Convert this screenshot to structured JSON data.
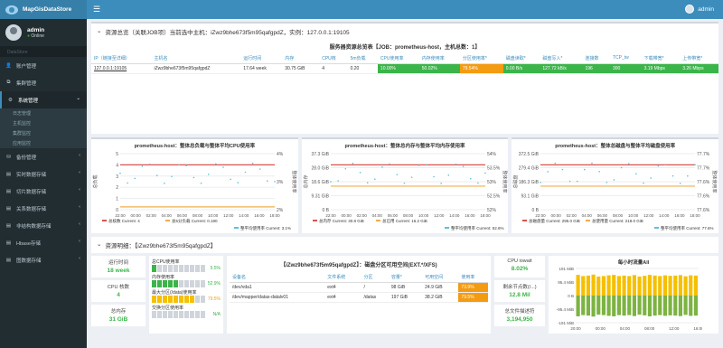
{
  "app": {
    "name": "MapGisDataStore",
    "user": "admin",
    "status": "Online"
  },
  "sidebar": {
    "head": "DataStore",
    "items": [
      {
        "label": "账户管理",
        "icon": "user-icon"
      },
      {
        "label": "集群管理",
        "icon": "cluster-icon"
      },
      {
        "label": "系统管理",
        "icon": "gear-icon",
        "sub": [
          "日志管理",
          "主机监控",
          "集群监控",
          "应用监控"
        ]
      },
      {
        "label": "备份管理",
        "icon": "backup-icon"
      },
      {
        "label": "实时数据存储",
        "icon": "database-icon"
      },
      {
        "label": "切片数据存储",
        "icon": "database-icon"
      },
      {
        "label": "关系数据存储",
        "icon": "database-icon"
      },
      {
        "label": "非结构数据存储",
        "icon": "database-icon"
      },
      {
        "label": "Hbase存储",
        "icon": "database-icon"
      },
      {
        "label": "图数据存储",
        "icon": "database-icon"
      }
    ]
  },
  "overview": {
    "title": "资源总览（关联JOB项）当前选中主机：iZwz9bhe673f5m95qafgpdZ，实例：127.0.0.1:19105",
    "table_title": "服务器资源总览表【JOB：prometheus-host，主机总数：1】",
    "headers": [
      "IP（链接至详细）",
      "主机名",
      "运行时间",
      "内存",
      "CPU核",
      "5m负载",
      "CPU使用率",
      "内存使用率",
      "分区使用率*",
      "磁盘读取*",
      "磁盘写入*",
      "连接数",
      "TCP_tw",
      "下载带宽*",
      "上传带宽*"
    ],
    "row": [
      "127.0.0.1:19105",
      "iZwz9bhe673f5m95qafgpdZ",
      "17.64 week",
      "30.75 GiB",
      "4",
      "0.20",
      "10.00%",
      "50.02%",
      "79.54%",
      "0.00 B/s",
      "127.72 kB/s",
      "196",
      "300",
      "3.19 Mbps",
      "3.26 Mbps"
    ]
  },
  "charts": [
    {
      "title": "prometheus-host：整体总负载与整体平均CPU使用率",
      "yleft": [
        "5",
        "4",
        "3",
        "2",
        "1",
        "0"
      ],
      "yright": [
        "4%",
        "3%",
        "2%"
      ],
      "x": [
        "22:00",
        "00:00",
        "02:00",
        "04:00",
        "06:00",
        "08:00",
        "10:00",
        "12:00",
        "14:00",
        "16:00",
        "18:00"
      ],
      "legend": [
        "总核数 Current: 4",
        "总5分负载 Current: 0.180",
        "整平均使用率 Current: 3.1%"
      ],
      "ylabel_left": "总负载",
      "ylabel_right": "整体使用率"
    },
    {
      "title": "prometheus-host：整体总内存与整体平均内存使用率",
      "yleft": [
        "37.3 GiB",
        "28.0 GiB",
        "18.6 GiB",
        "9.31 GiB",
        "0 B"
      ],
      "yright": [
        "54%",
        "53.5%",
        "53%",
        "52.5%",
        "52%"
      ],
      "x": [
        "22:00",
        "00:00",
        "02:00",
        "04:00",
        "06:00",
        "08:00",
        "10:00",
        "12:00",
        "14:00",
        "16:00",
        "18:00"
      ],
      "legend": [
        "总内存 Current: 30.8 GiB",
        "总已用 Current: 16.2 GiB",
        "整平均使用率 Current: 52.6%"
      ],
      "ylabel_left": "总内存",
      "ylabel_right": "整体使用率"
    },
    {
      "title": "prometheus-host：整体总磁盘与整体平均磁盘使用率",
      "yleft": [
        "372.5 GiB",
        "279.4 GiB",
        "186.3 GiB",
        "93.1 GiB",
        "0 B"
      ],
      "yright": [
        "77.7%",
        "77.7%",
        "77.6%",
        "77.6%",
        "77.6%"
      ],
      "x": [
        "22:00",
        "00:00",
        "02:00",
        "04:00",
        "06:00",
        "08:00",
        "10:00",
        "12:00",
        "14:00",
        "16:00",
        "18:00"
      ],
      "legend": [
        "总磁盘量 Current: 295.0 GiB",
        "总使用量 Current: 218.0 GiB",
        "整平均使用率 Current: 77.6%"
      ],
      "ylabel_left": "总磁盘",
      "ylabel_right": "整体使用率"
    }
  ],
  "detail": {
    "title": "资源明细：【iZwz9bhe673f5m95qafgpdZ】",
    "uptime": {
      "label": "运行时间",
      "value": "18 week"
    },
    "cpu": {
      "label": "CPU 核数",
      "value": "4"
    },
    "mem": {
      "label": "总内存",
      "value": "31 GiB"
    },
    "gauges": [
      {
        "label": "总CPU使用率",
        "value": "5.5%"
      },
      {
        "label": "内存使用率",
        "value": "52.9%"
      },
      {
        "label": "最大分区(/data)使用率",
        "value": "79.5%"
      },
      {
        "label": "交换分区使用率",
        "value": "N/A"
      }
    ],
    "part_title": "【iZwz9bhe673f5m95qafgpdZ】：磁盘分区可用空间(EXT.*/XFS)",
    "part_headers": [
      "设备名",
      "文件系统",
      "分区",
      "容量*",
      "可用空间",
      "使用率"
    ],
    "part_rows": [
      [
        "/dev/vda1",
        "ext4",
        "/",
        "98 GiB",
        "24.9 GiB",
        "73.9%"
      ],
      [
        "/dev/mapper/datas-datalv01",
        "ext4",
        "/datas",
        "197 GiB",
        "38.2 GiB",
        "79.5%"
      ]
    ],
    "iowait": {
      "label": "CPU iowait",
      "value": "8.02%"
    },
    "nodes": {
      "label": "剩余节点数(/...)",
      "value": "12.8 Mil"
    },
    "tcp": {
      "label": "总文件描述符",
      "value": "3,194,950"
    },
    "traffic": {
      "title": "每小时流量All",
      "y": [
        "191 MiB",
        "95.4 MiB",
        "0 B",
        "-95.4 MiB",
        "-191 MiB"
      ],
      "x": [
        "20:00",
        "00:00",
        "04:00",
        "08:00",
        "12:00",
        "16:00"
      ],
      "values": [
        0.85,
        0.8,
        0.82,
        0.86,
        0.78,
        0.8,
        0.83,
        0.85,
        0.8,
        0.82,
        0.8,
        0.84,
        0.78,
        0.81,
        0.85,
        0.82,
        0.8,
        0.83,
        0.81,
        0.82,
        0.84,
        0.79,
        0.83,
        0.82
      ]
    }
  }
}
